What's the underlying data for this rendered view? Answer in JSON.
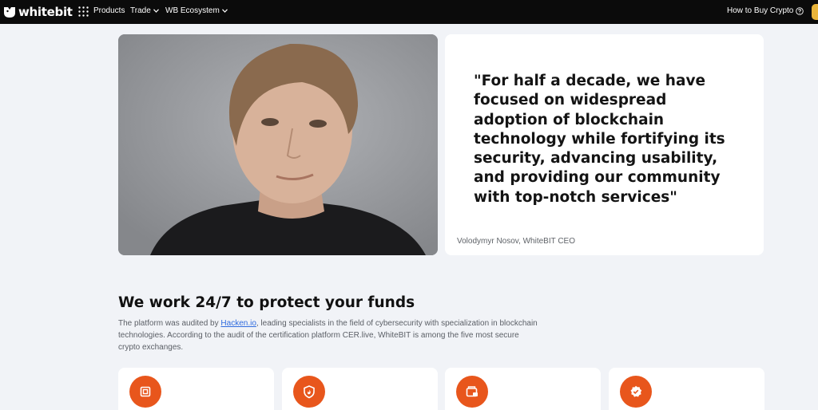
{
  "header": {
    "logo_text": "whitebit",
    "nav": [
      {
        "label": "Products",
        "has_dropdown": false
      },
      {
        "label": "Trade",
        "has_dropdown": true
      },
      {
        "label": "WB Ecosystem",
        "has_dropdown": true
      }
    ],
    "right_link": "How to Buy Crypto",
    "accent_color": "#e9b43a"
  },
  "quote": {
    "text": "\"For half a decade, we have focused on widespread adoption of blockchain technology while fortifying its security, advancing usability, and providing our community with top-notch services\"",
    "author": "Volodymyr Nosov, WhiteBIT CEO"
  },
  "security": {
    "title": "We work 24/7 to protect your funds",
    "desc_before": "The platform was audited by ",
    "desc_link": "Hacken.io",
    "desc_after": ", leading specialists in the field of cybersecurity with specialization in blockchain technologies. According to the audit of the certification platform CER.live, WhiteBIT is among the five most secure crypto exchanges.",
    "features": [
      {
        "icon": "chip-icon"
      },
      {
        "icon": "shield-fire-icon"
      },
      {
        "icon": "wallet-icon"
      },
      {
        "icon": "badge-check-icon"
      }
    ],
    "icon_color": "#e8561c"
  }
}
